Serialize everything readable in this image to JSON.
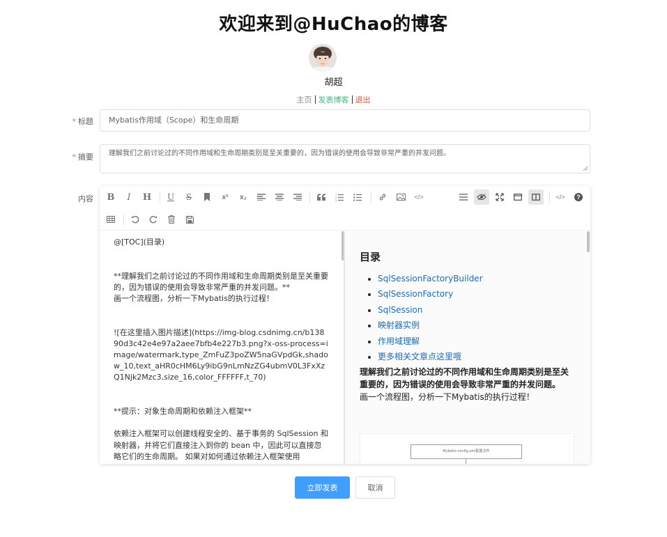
{
  "header": {
    "title": "欢迎来到@HuChao的博客",
    "username": "胡超"
  },
  "nav": {
    "home": "主页",
    "publish": "发表博客",
    "logout": "退出"
  },
  "form": {
    "title_label": "标题",
    "title_value": "Mybatis作用域（Scope）和生命周期",
    "summary_label": "摘要",
    "summary_value": "理解我们之前讨论过的不同作用域和生命周期类别是至关重要的，因为错误的使用会导致非常严重的并发问题。",
    "content_label": "内容",
    "required_mark": "*"
  },
  "toolbar": {
    "row1_left": [
      "bold-icon",
      "italic-icon",
      "heading-icon",
      "underline-icon",
      "strikethrough-icon",
      "bookmark-icon",
      "superscript-icon",
      "subscript-icon",
      "align-left-icon",
      "align-center-icon",
      "align-right-icon",
      "quote-icon",
      "ordered-list-icon",
      "unordered-list-icon",
      "link-icon",
      "image-icon",
      "code-icon"
    ],
    "row1_right": [
      "navigation-icon",
      "preview-icon",
      "fullscreen-icon",
      "read-mode-icon",
      "subfield-icon",
      "html-code-icon",
      "help-icon"
    ],
    "row2": [
      "table-icon",
      "undo-icon",
      "redo-icon",
      "trash-icon",
      "save-icon"
    ],
    "labels": {
      "bold": "B",
      "italic": "I",
      "heading": "H",
      "underline": "U",
      "strike": "S",
      "sup": "x²",
      "sub": "x₂",
      "code": "</>",
      "help": "?"
    }
  },
  "editor": {
    "markdown_lines": [
      "@[TOC](目录)",
      "",
      "",
      "**理解我们之前讨论过的不同作用域和生命周期类别是至关重要的，因为错误的使用会导致非常严重的并发问题。**",
      "画一个流程图，分析一下Mybatis的执行过程！",
      "",
      "",
      "![在这里插入图片描述](https://img-blog.csdnimg.cn/b13890d3c42e4e97a2aee7bfb4e227b3.png?x-oss-process=image/watermark,type_ZmFuZ3poZW5naGVpdGk,shadow_10,text_aHR0cHM6Ly9ibG9nLmNzZG4ubmV0L3FxXzQ1Njk2Mzc3,size_16,color_FFFFFF,t_70)",
      "",
      "",
      "**提示：对象生命周期和依赖注入框架**",
      "",
      "依赖注入框架可以创建线程安全的、基于事务的 SqlSession 和映射器，并将它们直接注入到你的 bean 中，因此可以直接忽略它们的生命周期。 如果对如何通过依赖注入框架使用"
    ],
    "preview": {
      "toc_title": "目录",
      "toc_items": [
        "SqlSessionFactoryBuilder",
        "SqlSessionFactory",
        "SqlSession",
        "映射器实例",
        "作用域理解",
        "更多相关文章点这里哦"
      ],
      "bold_paragraph": "理解我们之前讨论过的不同作用域和生命周期类别是至关重要的，因为错误的使用会导致非常严重的并发问题。",
      "paragraph": "画一个流程图，分析一下Mybatis的执行过程！",
      "image_box_text": "Mybatis-config.xml配置文件"
    }
  },
  "buttons": {
    "submit": "立即发表",
    "cancel": "取消"
  },
  "colors": {
    "primary": "#409eff",
    "link_green": "#42b983",
    "logout_red": "#e2533d",
    "toc_link": "#1e6bb8",
    "required": "#f56c6c"
  }
}
